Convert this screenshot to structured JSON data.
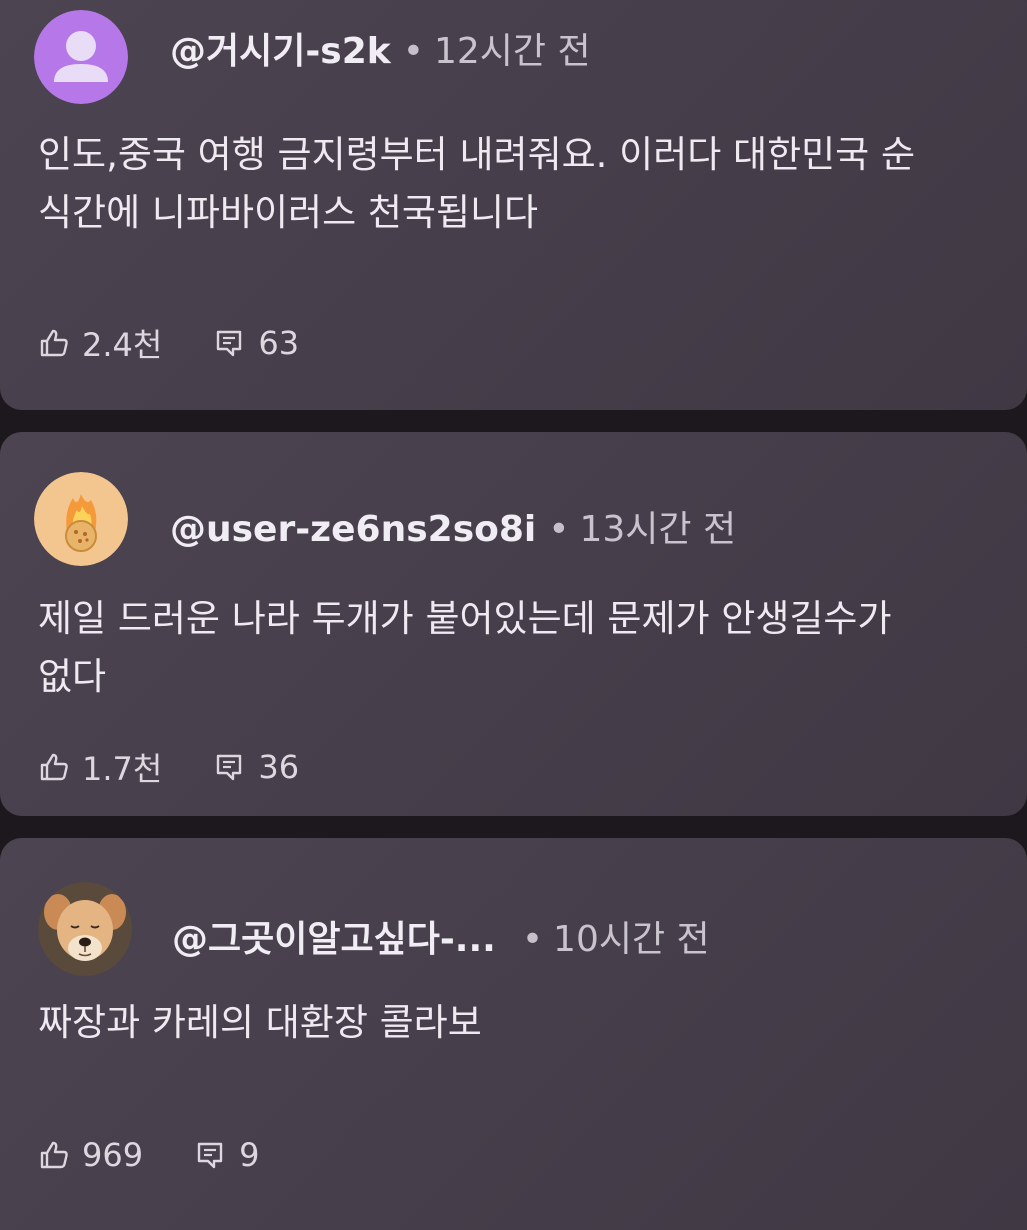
{
  "comments": [
    {
      "author": "@거시기-s2k",
      "separator": "•",
      "time": "12시간 전",
      "text": "인도,중국 여행 금지령부터 내려줘요. 이러다 대한민국 순\n식간에 니파바이러스 천국됩니다",
      "likes": "2.4천",
      "replies": "63",
      "avatar": "default-person-avatar",
      "avatar_bg": "#b678e9"
    },
    {
      "author": "@user-ze6ns2so8i",
      "separator": "•",
      "time": "13시간 전",
      "text": "제일 드러운 나라 두개가 붙어있는데 문제가 안생길수가\n없다",
      "likes": "1.7천",
      "replies": "36",
      "avatar": "pizza-flame-avatar",
      "avatar_bg": "#f3c58f"
    },
    {
      "author": "@그곳이알고싶다-...",
      "separator": "•",
      "time": "10시간 전",
      "text": "짜장과 카레의 대환장 콜라보",
      "likes": "969",
      "replies": "9",
      "avatar": "dog-photo-avatar",
      "avatar_bg": "#5a4a3c"
    }
  ],
  "icons": {
    "like": "thumbs-up-icon",
    "reply": "comment-icon"
  }
}
